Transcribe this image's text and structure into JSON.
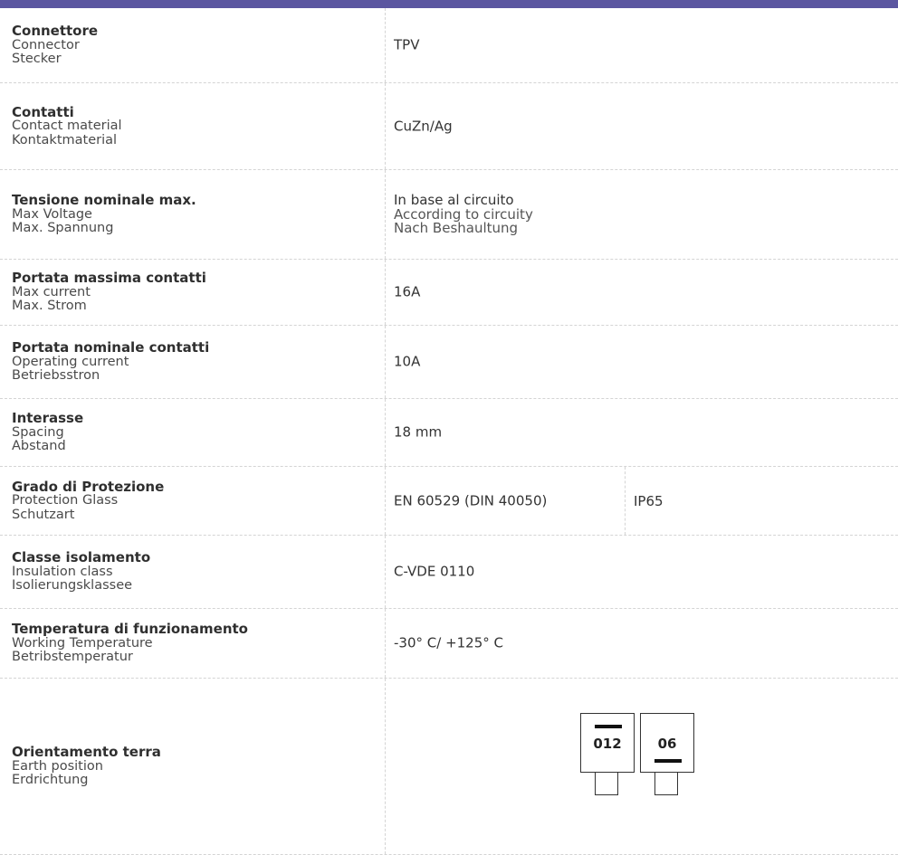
{
  "rows": [
    {
      "it": "Connettore",
      "en": "Connector",
      "de": "Stecker",
      "value": "TPV"
    },
    {
      "it": "Contatti",
      "en": "Contact material",
      "de": "Kontaktmaterial",
      "value": "CuZn/Ag"
    },
    {
      "it": "Tensione nominale max.",
      "en": "Max Voltage",
      "de": "Max. Spannung",
      "value_it": "In base al circuito",
      "value_en": "According to circuity",
      "value_de": "Nach Beshaultung"
    },
    {
      "it": "Portata massima contatti",
      "en": "Max current",
      "de": "Max. Strom",
      "value": "16A"
    },
    {
      "it": "Portata nominale contatti",
      "en": "Operating current",
      "de": "Betriebsstron",
      "value": "10A"
    },
    {
      "it": "Interasse",
      "en": "Spacing",
      "de": "Abstand",
      "value": "18 mm"
    },
    {
      "it": "Grado di Protezione",
      "en": "Protection Glass",
      "de": "Schutzart",
      "value": "EN 60529 (DIN 40050)",
      "value_extra": "IP65"
    },
    {
      "it": "Classe isolamento",
      "en": "Insulation class",
      "de": "Isolierungsklassee",
      "value": "C-VDE 0110"
    },
    {
      "it": "Temperatura di funzionamento",
      "en": "Working Temperature",
      "de": "Betribstemperatur",
      "value": "-30° C/ +125° C"
    },
    {
      "it": "Orientamento terra",
      "en": "Earth position",
      "de": "Erdrichtung"
    }
  ],
  "earth_diagram": {
    "left_code": "012",
    "right_code": "06"
  },
  "colors": {
    "top_bar": "#5b56a0",
    "divider": "#d4d4d4"
  }
}
